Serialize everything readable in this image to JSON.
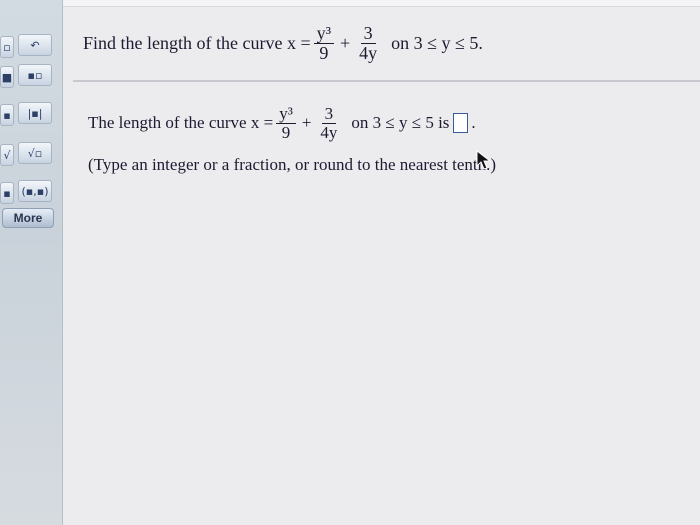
{
  "sidebar": {
    "more_label": "More"
  },
  "question": {
    "prefix": "Find the length of the curve x =",
    "frac1": {
      "num": "y³",
      "den": "9"
    },
    "plus": "+",
    "frac2": {
      "num": "3",
      "den": "4y"
    },
    "suffix": "on 3 ≤ y ≤ 5."
  },
  "answer": {
    "prefix": "The length of the curve x =",
    "frac1": {
      "num": "y³",
      "den": "9"
    },
    "plus": "+",
    "frac2": {
      "num": "3",
      "den": "4y"
    },
    "suffix": "on 3 ≤ y ≤ 5 is",
    "period": ".",
    "input_value": ""
  },
  "instruction": "(Type an integer or a fraction, or round to the nearest tenth.)",
  "colors": {
    "background": "#ecebee",
    "sidebar": "#cfd7df",
    "input_border": "#3a5a9a"
  }
}
